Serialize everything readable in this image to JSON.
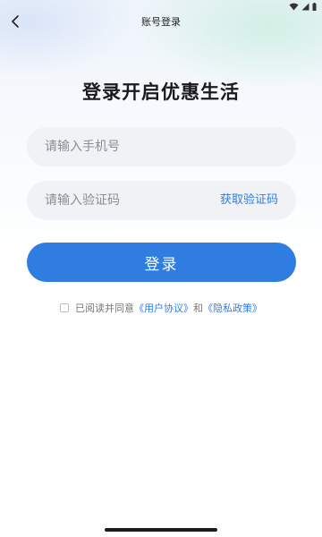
{
  "nav": {
    "title": "账号登录"
  },
  "headline": "登录开启优惠生活",
  "phone_field": {
    "placeholder": "请输入手机号",
    "value": ""
  },
  "code_field": {
    "placeholder": "请输入验证码",
    "value": "",
    "get_code_label": "获取验证码"
  },
  "login_button": {
    "label": "登录"
  },
  "agreement": {
    "prefix": "已阅读并同意",
    "user_agreement": "《用户协议》",
    "conjunction": "和",
    "privacy_policy": "《隐私政策》"
  },
  "colors": {
    "accent": "#2f7de1",
    "field_bg": "#f1f2f6"
  },
  "icons": {
    "back": "back-arrow-icon",
    "wifi": "wifi-icon",
    "signal": "signal-icon",
    "battery": "battery-icon"
  }
}
